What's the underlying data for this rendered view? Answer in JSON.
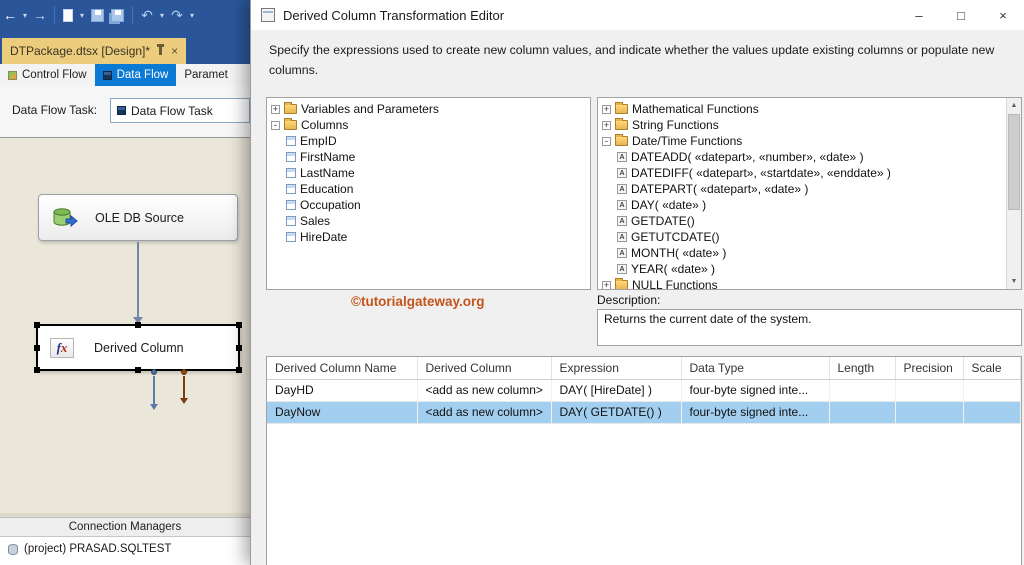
{
  "vs": {
    "toolbar": [
      {
        "type": "glyph",
        "name": "back-button",
        "glyph": "←",
        "color": "#ffffff"
      },
      {
        "type": "glyph",
        "name": "back-dropdown-icon",
        "glyph": "▾",
        "small": true
      },
      {
        "type": "glyph",
        "name": "forward-button",
        "glyph": "→",
        "color": "#c3d2ea"
      },
      {
        "type": "sep",
        "name": "toolbar-separator"
      },
      {
        "type": "shape",
        "name": "new-file-button",
        "shape": "page"
      },
      {
        "type": "glyph",
        "name": "new-file-dropdown-icon",
        "glyph": "▾",
        "small": true
      },
      {
        "type": "shape",
        "name": "save-button",
        "shape": "floppy"
      },
      {
        "type": "shape",
        "name": "save-all-button",
        "shape": "floppy-all"
      },
      {
        "type": "sep",
        "name": "toolbar-separator"
      },
      {
        "type": "glyph",
        "name": "undo-button",
        "glyph": "↶",
        "color": "#aecdf5"
      },
      {
        "type": "glyph",
        "name": "undo-dropdown-icon",
        "glyph": "▾",
        "small": true
      },
      {
        "type": "glyph",
        "name": "redo-button",
        "glyph": "↷",
        "color": "#aecdf5"
      },
      {
        "type": "glyph",
        "name": "redo-dropdown-icon",
        "glyph": "▾",
        "small": true
      }
    ],
    "doc_tab": {
      "label": "DTPackage.dtsx [Design]*",
      "close": "×"
    },
    "design_tabs": [
      {
        "label": "Control Flow"
      },
      {
        "label": "Data Flow"
      },
      {
        "label": "Paramet"
      }
    ],
    "task_selector": {
      "label": "Data Flow Task:",
      "value": "Data Flow Task"
    },
    "canvas": {
      "source": "OLE DB Source",
      "derived": "Derived Column"
    },
    "connection_managers": {
      "title": "Connection Managers",
      "item": "(project) PRASAD.SQLTEST"
    }
  },
  "dialog": {
    "title": "Derived Column Transformation Editor",
    "window": {
      "minimize": "–",
      "maximize": "□",
      "close": "×"
    },
    "intro": "Specify the expressions used to create new column values, and indicate whether the values update existing columns or populate new columns.",
    "left_tree": [
      {
        "label": "Variables and Parameters",
        "type": "folder",
        "expanded": false,
        "indent": 0
      },
      {
        "label": "Columns",
        "type": "folder",
        "expanded": true,
        "indent": 0
      },
      {
        "label": "EmpID",
        "type": "column",
        "indent": 1
      },
      {
        "label": "FirstName",
        "type": "column",
        "indent": 1
      },
      {
        "label": "LastName",
        "type": "column",
        "indent": 1
      },
      {
        "label": "Education",
        "type": "column",
        "indent": 1
      },
      {
        "label": "Occupation",
        "type": "column",
        "indent": 1
      },
      {
        "label": "Sales",
        "type": "column",
        "indent": 1
      },
      {
        "label": "HireDate",
        "type": "column",
        "indent": 1
      }
    ],
    "right_tree": [
      {
        "label": "Mathematical Functions",
        "type": "folder",
        "expanded": false,
        "indent": 0
      },
      {
        "label": "String Functions",
        "type": "folder",
        "expanded": false,
        "indent": 0
      },
      {
        "label": "Date/Time Functions",
        "type": "folder",
        "expanded": true,
        "indent": 0
      },
      {
        "label": "DATEADD( «datepart», «number», «date» )",
        "type": "function",
        "indent": 1
      },
      {
        "label": "DATEDIFF( «datepart», «startdate», «enddate» )",
        "type": "function",
        "indent": 1
      },
      {
        "label": "DATEPART( «datepart», «date» )",
        "type": "function",
        "indent": 1
      },
      {
        "label": "DAY( «date» )",
        "type": "function",
        "indent": 1
      },
      {
        "label": "GETDATE()",
        "type": "function",
        "indent": 1
      },
      {
        "label": "GETUTCDATE()",
        "type": "function",
        "indent": 1
      },
      {
        "label": "MONTH( «date» )",
        "type": "function",
        "indent": 1
      },
      {
        "label": "YEAR( «date» )",
        "type": "function",
        "indent": 1
      },
      {
        "label": "NULL Functions",
        "type": "folder",
        "expanded": false,
        "indent": 0
      }
    ],
    "watermark": "©tutorialgateway.org",
    "description": {
      "label": "Description:",
      "value": "Returns the current date of the system."
    },
    "grid": {
      "columns": [
        "Derived Column Name",
        "Derived Column",
        "Expression",
        "Data Type",
        "Length",
        "Precision",
        "Scale"
      ],
      "rows": [
        {
          "selected": false,
          "cells": [
            "DayHD",
            "<add as new column>",
            "DAY( [HireDate] )",
            "four-byte signed inte...",
            "",
            "",
            ""
          ]
        },
        {
          "selected": true,
          "cells": [
            "DayNow",
            "<add as new column>",
            "DAY( GETDATE() )",
            "four-byte signed inte...",
            "",
            "",
            ""
          ]
        }
      ]
    }
  }
}
